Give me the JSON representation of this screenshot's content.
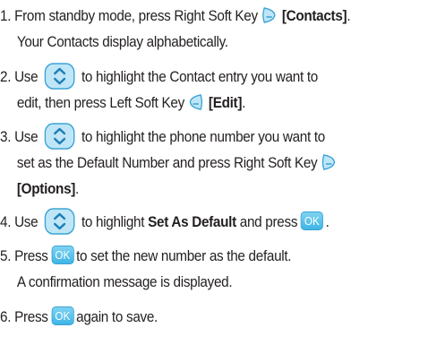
{
  "steps": [
    {
      "number": "1.",
      "text_a": "From standby mode, press Right Soft Key",
      "icon": "right-soft-key-icon",
      "bold": "[Contacts]",
      "text_b": ".",
      "line2": "Your Contacts display alphabetically."
    },
    {
      "number": "2.",
      "text_a": "Use",
      "icon": "navigation-key-icon",
      "text_b": "to highlight the Contact entry you want to",
      "line2_a": "edit, then press Left Soft Key",
      "line2_icon": "left-soft-key-icon",
      "line2_bold": "[Edit]",
      "line2_b": "."
    },
    {
      "number": "3.",
      "text_a": "Use",
      "icon": "navigation-key-icon",
      "text_b": "to highlight the phone number you want to",
      "line2_a": "set as the Default Number and press Right Soft Key",
      "line2_icon": "right-soft-key-icon",
      "line3_bold": "[Options]",
      "line3_b": "."
    },
    {
      "number": "4.",
      "text_a": "Use",
      "icon": "navigation-key-icon",
      "text_b": "to highlight",
      "bold": "Set As Default",
      "text_c": "and press",
      "icon2": "ok-key-icon",
      "ok_label": "OK",
      "text_d": "."
    },
    {
      "number": "5.",
      "text_a": "Press",
      "icon": "ok-key-icon",
      "ok_label": "OK",
      "text_b": "to set the new number as the default.",
      "line2": "A confirmation message is displayed."
    },
    {
      "number": "6.",
      "text_a": "Press",
      "icon": "ok-key-icon",
      "ok_label": "OK",
      "text_b": "again to save."
    }
  ],
  "colors": {
    "text": "#231f20",
    "key_fill": "#bfe6f7",
    "key_outline": "#3aa3d4",
    "ok_fill": "#3fb5e6"
  }
}
